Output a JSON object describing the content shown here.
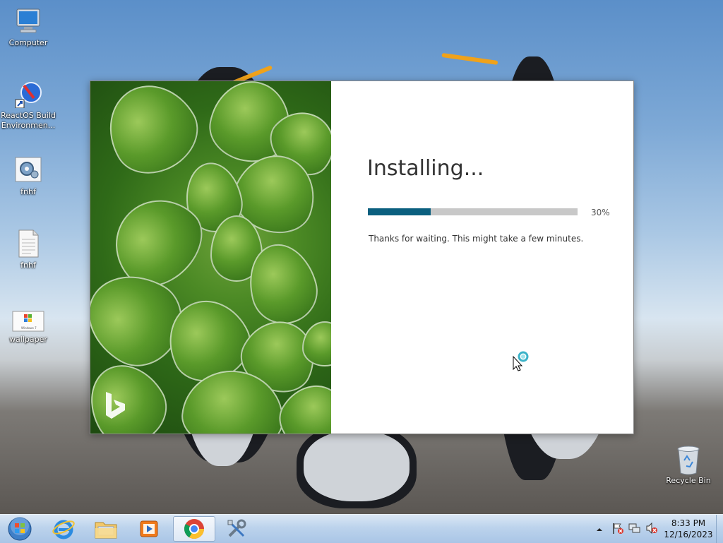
{
  "desktop": {
    "icons": [
      {
        "label": "Computer"
      },
      {
        "label": "ReactOS Build\nEnvironmen..."
      },
      {
        "label": "fnhf"
      },
      {
        "label": "fnhf"
      },
      {
        "label": "wallpaper"
      },
      {
        "label": "Recycle Bin"
      }
    ],
    "wallpaper_thumb_text": "Windows 7"
  },
  "installer": {
    "title": "Installing...",
    "progress_fraction": 0.3,
    "progress_label": "30%",
    "message": "Thanks for waiting. This might take a few minutes.",
    "accent_color": "#0b5f7f",
    "logo": "bing-logo"
  },
  "taskbar": {
    "pinned": [
      "start-orb-icon",
      "internet-explorer-icon",
      "file-explorer-icon",
      "media-player-icon",
      "chrome-icon",
      "tools-icon"
    ],
    "active": "chrome-icon",
    "tray_icons": [
      "show-hidden-icons-arrow",
      "action-center-flag-icon",
      "network-icon",
      "volume-muted-icon"
    ],
    "time": "8:33 PM",
    "date": "12/16/2023"
  }
}
